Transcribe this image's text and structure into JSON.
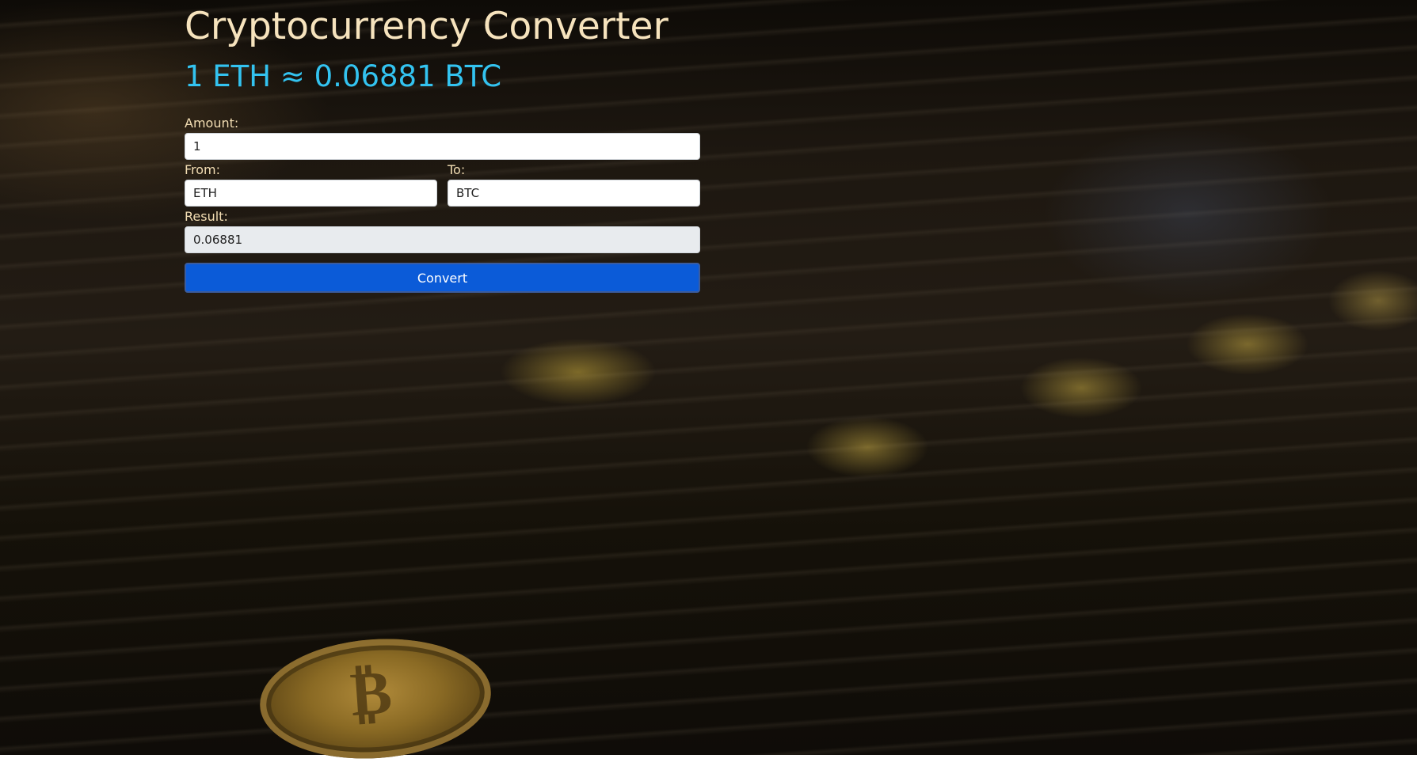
{
  "page": {
    "title": "Cryptocurrency Converter",
    "rate_text": "1 ETH ≈ 0.06881 BTC"
  },
  "form": {
    "amount_label": "Amount:",
    "amount_value": "1",
    "from_label": "From:",
    "from_value": "ETH",
    "to_label": "To:",
    "to_value": "BTC",
    "result_label": "Result:",
    "result_value": "0.06881",
    "convert_label": "Convert"
  },
  "colors": {
    "title": "#f6e3bd",
    "rate": "#33c3f0",
    "button": "#0b5bd8",
    "result_bg": "#e8ebee"
  },
  "background": {
    "description_icon": "bitcoin-coins-photo"
  }
}
